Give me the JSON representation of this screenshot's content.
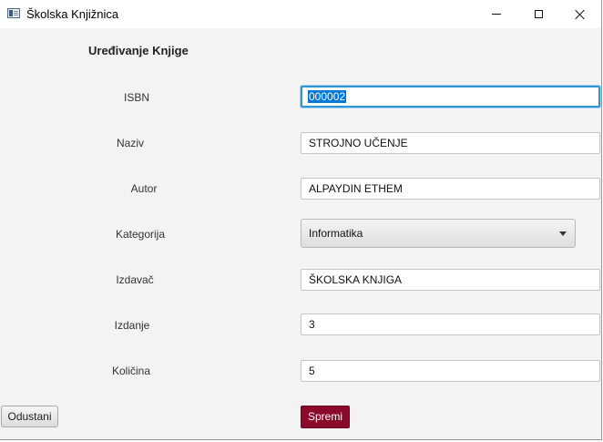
{
  "window": {
    "title": "Školska Knjižnica",
    "icon": "app-window-icon"
  },
  "form": {
    "title": "Uređivanje Knjige",
    "fields": {
      "isbn": {
        "label": "ISBN",
        "value": "000002"
      },
      "naziv": {
        "label": "Naziv",
        "value": "STROJNO UČENJE"
      },
      "autor": {
        "label": "Autor",
        "value": "ALPAYDIN ETHEM"
      },
      "kategorija": {
        "label": "Kategorija",
        "value": "Informatika"
      },
      "izdavac": {
        "label": "Izdavač",
        "value": "ŠKOLSKA KNJIGA"
      },
      "izdanje": {
        "label": "Izdanje",
        "value": "3"
      },
      "kolicina": {
        "label": "Količina",
        "value": "5"
      }
    }
  },
  "buttons": {
    "cancel": "Odustani",
    "save": "Spremi"
  },
  "colors": {
    "accent": "#8b0a2a",
    "focus": "#2f96d8",
    "selection": "#0078d7"
  }
}
